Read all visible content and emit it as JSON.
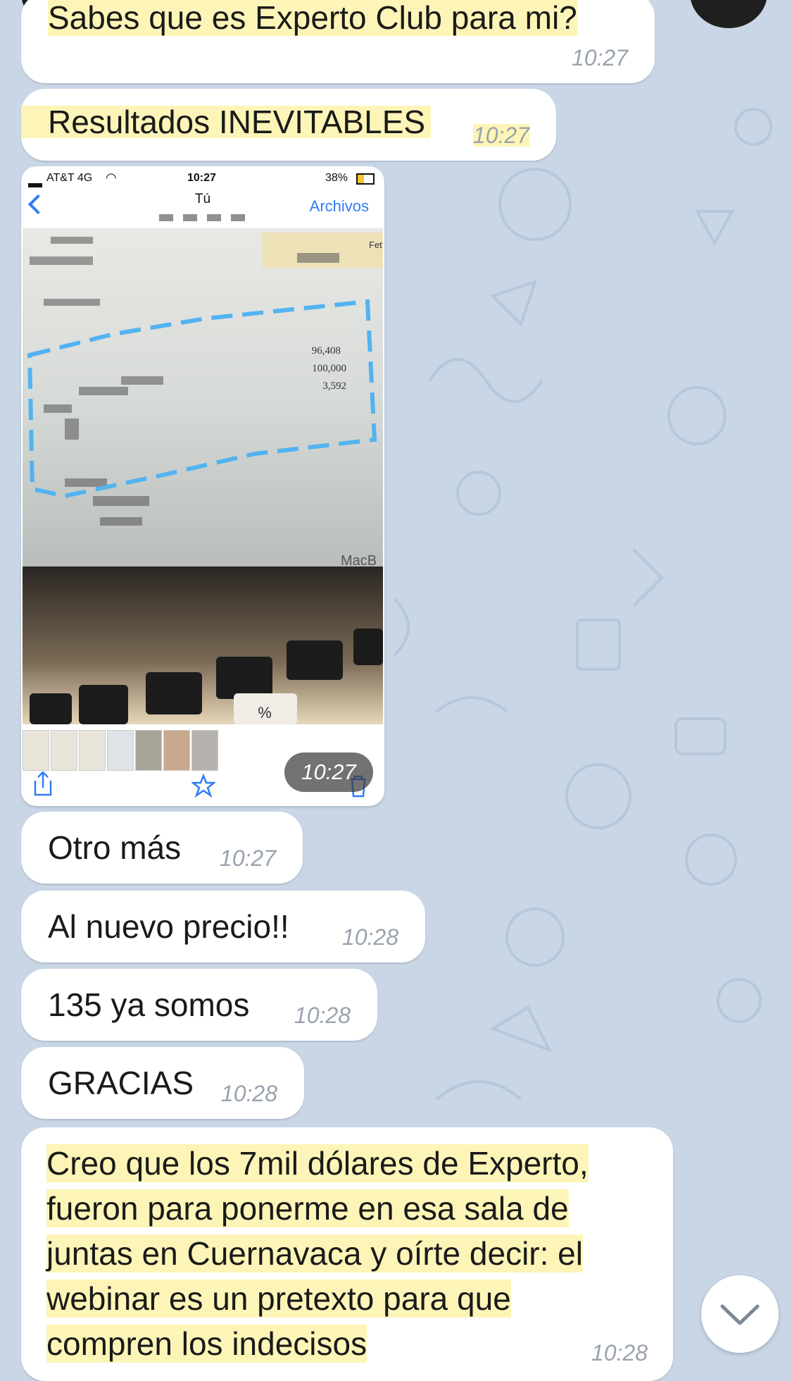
{
  "messages": [
    {
      "text": "Sabes que es Experto Club para mi?",
      "time": "10:27"
    },
    {
      "text": "Resultados INEVITABLES",
      "time": "10:27"
    },
    {
      "text": "Otro más",
      "time": "10:27"
    },
    {
      "text": "Al nuevo precio!!",
      "time": "10:28"
    },
    {
      "text": "135 ya somos",
      "time": "10:28"
    },
    {
      "text": "GRACIAS",
      "time": "10:28"
    }
  ],
  "photo": {
    "carrier": "AT&T 4G",
    "clock": "10:27",
    "battery": "38%",
    "title": "Tú",
    "files_link": "Archivos",
    "values": [
      "96,408",
      "100,000",
      "3,592"
    ],
    "brand": "MacB",
    "time": "10:27",
    "label_fet": "Fet"
  },
  "long_message": {
    "lines": [
      "Creo que los 7mil dólares de Experto,",
      "fueron para ponerme en esa sala de",
      "juntas en Cuernavaca y oírte decir: el",
      "webinar es un pretexto para que",
      "compren los indecisos"
    ],
    "time": "10:28"
  },
  "colors": {
    "background": "#c9d6e6",
    "highlight": "#fdf5b7",
    "link": "#2f7cf6"
  },
  "icons": [
    "back-chevron-icon",
    "share-icon",
    "star-icon",
    "trash-icon",
    "chevron-down-icon",
    "wifi-icon",
    "signal-icon"
  ]
}
